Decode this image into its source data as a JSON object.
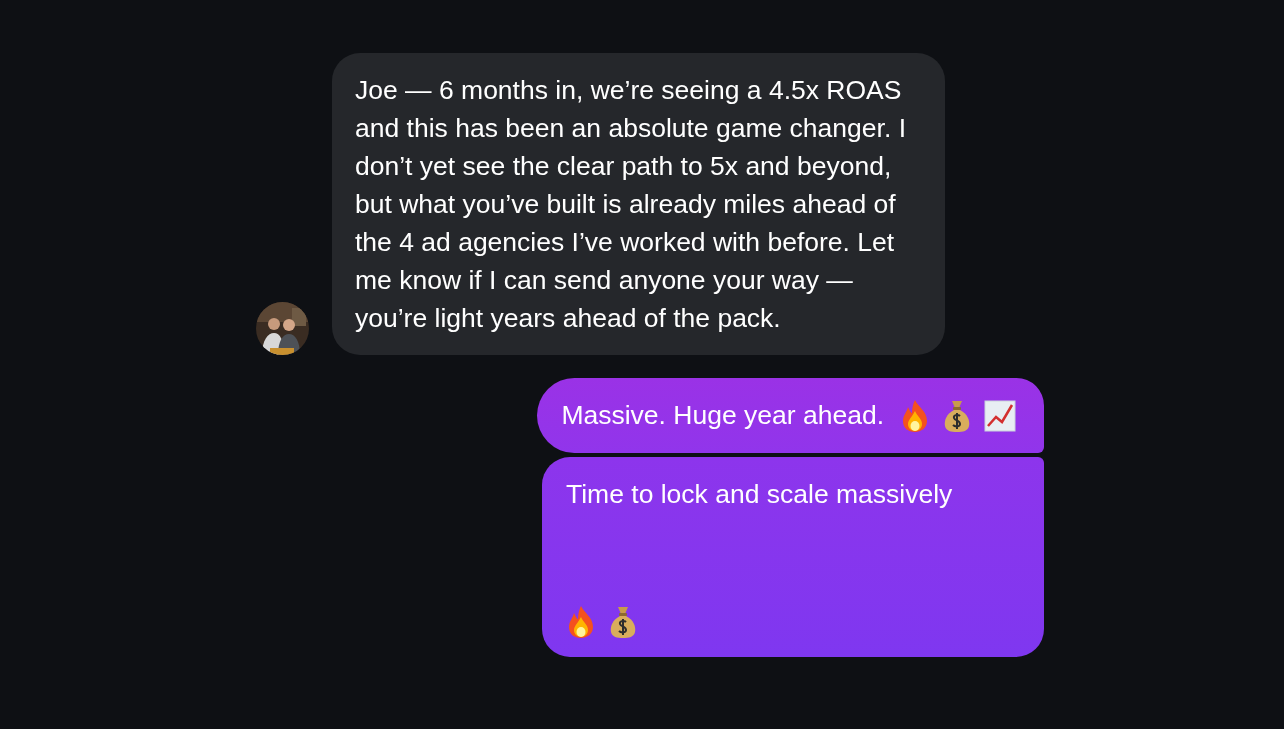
{
  "messages": [
    {
      "kind": "received",
      "text": "Joe — 6 months in, we’re seeing a 4.5x ROAS and this has been an absolute game changer. I don’t yet see the clear path to 5x and beyond, but what you’ve built is already miles ahead of the 4 ad agencies I’ve worked with before. Let me know if I can send anyone your way — you’re light years ahead of the pack."
    },
    {
      "kind": "sent",
      "text": "Massive. Huge year ahead.",
      "emojis": [
        {
          "kind": "fire"
        },
        {
          "kind": "money-bag"
        },
        {
          "kind": "chart"
        }
      ]
    },
    {
      "kind": "sent-tall",
      "text": "Time to lock and scale massively",
      "emojis": [
        {
          "kind": "fire"
        },
        {
          "kind": "money-bag"
        }
      ]
    }
  ]
}
